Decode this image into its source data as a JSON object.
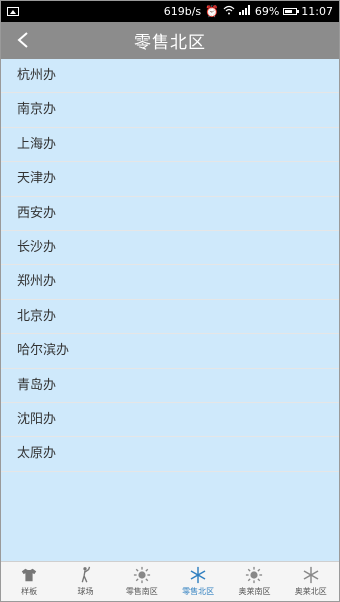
{
  "status": {
    "speed": "619b/s",
    "battery_pct": "69%",
    "time": "11:07"
  },
  "header": {
    "title": "零售北区"
  },
  "offices": [
    "杭州办",
    "南京办",
    "上海办",
    "天津办",
    "西安办",
    "长沙办",
    "郑州办",
    "北京办",
    "哈尔滨办",
    "青岛办",
    "沈阳办",
    "太原办"
  ],
  "tabs": [
    {
      "label": "样板",
      "icon": "shirt-icon"
    },
    {
      "label": "球场",
      "icon": "golfer-icon"
    },
    {
      "label": "零售南区",
      "icon": "sun-icon"
    },
    {
      "label": "零售北区",
      "icon": "snowflake-icon",
      "active": true
    },
    {
      "label": "奥莱南区",
      "icon": "sun-icon"
    },
    {
      "label": "奥莱北区",
      "icon": "snowflake-icon"
    }
  ],
  "colors": {
    "header_bg": "#8c8c8c",
    "list_bg": "#cfe9fb",
    "active_tab": "#2f7fc0"
  }
}
